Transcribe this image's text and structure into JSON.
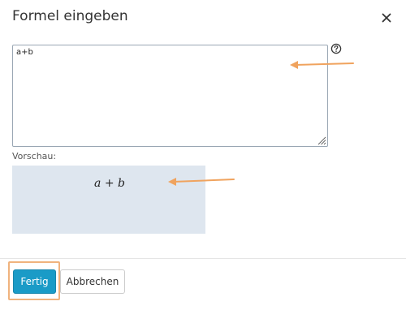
{
  "dialog": {
    "title": "Formel eingeben",
    "close_icon": "close-icon",
    "help_icon": "question-circle-icon"
  },
  "editor": {
    "value": "a+b"
  },
  "preview": {
    "label": "Vorschau:",
    "rendered": "a + b"
  },
  "footer": {
    "done_label": "Fertig",
    "cancel_label": "Abbrechen"
  },
  "colors": {
    "primary_button": "#1a9bc7",
    "preview_background": "#dee6ef",
    "annotation_arrow": "#f0a35e",
    "annotation_highlight": "#f0b37e"
  }
}
